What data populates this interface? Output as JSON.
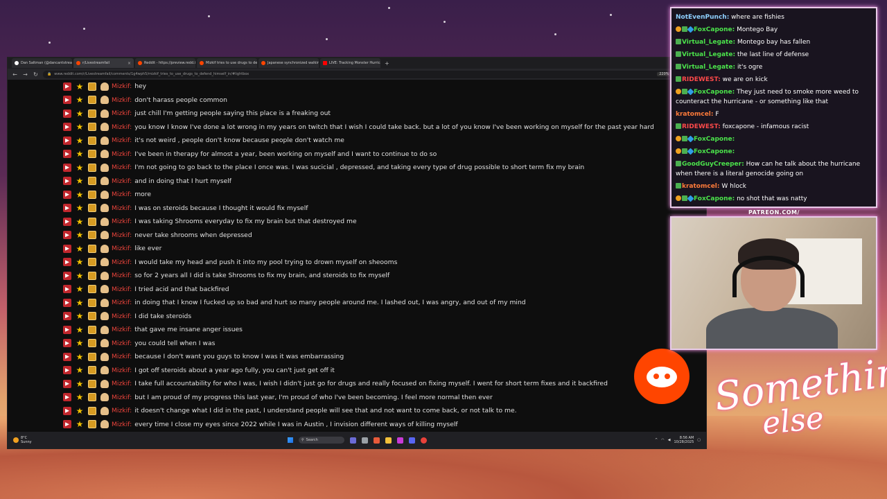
{
  "browser": {
    "tabs": [
      {
        "label": "Dan Saltman (@dancantstream)",
        "icon": "x-icon",
        "active": false
      },
      {
        "label": "r/Livestreamfail",
        "icon": "reddit-icon",
        "active": true
      },
      {
        "label": "Reddit - https://preview.redd.it/",
        "icon": "reddit-icon",
        "active": false
      },
      {
        "label": "Mizkif tries to use drugs to def",
        "icon": "reddit-icon",
        "active": false
      },
      {
        "label": "Japanese synchronized walking",
        "icon": "reddit-icon",
        "active": false
      },
      {
        "label": "LIVE: Tracking Monster Hurrican",
        "icon": "youtube-icon",
        "active": false
      }
    ],
    "url": "www.reddit.com/r/Livestreamfail/comments/1g4wph5/mizkif_tries_to_use_drugs_to_defend_himself_in/#lightbox",
    "zoom": "220%"
  },
  "chat": {
    "username": "Mizkif:",
    "messages": [
      "hey",
      "don't harass people common",
      "just chill I'm getting people saying this place is a freaking out",
      "you know I know I've done a lot wrong in my years on twitch that I wish I could take back. but a lot of you know I've been working on myself for the past year hard",
      "it's not weird , people don't know because people don't watch me",
      "I've been in therapy for almost a year, been working on myself and I want to continue to do so",
      "I'm not going to go back to the place I once was. I was sucicial , depressed, and taking every type of drug possible to short term fix my brain",
      "and in doing that I hurt myself",
      "more",
      "I was on steroids because I thought it would fix myself",
      "I was taking Shrooms everyday to fix my brain but that destroyed me",
      "never take shrooms when depressed",
      "like ever",
      "I would take my head and push it into my pool trying to drown myself on sheooms",
      "so for 2 years all I did is take Shrooms to fix my brain, and steroids to fix myself",
      "I tried acid and that backfired",
      "in doing that I know I fucked up so bad and hurt so many people around me. I lashed out, I was angry, and out of my mind",
      "I did take steroids",
      "that gave me insane anger issues",
      "you could tell when I was",
      "because I don't want you guys to know I was it was embarrassing",
      "I got off steroids about a year ago fully, you can't just get off it",
      "I take full accountability for who I was, I wish I didn't just go for drugs and really focused on fixing myself. I went for short term fixes and it backfired",
      "but I am proud of my progress this last year, I'm proud of who I've been becoming. I feel more normal then ever",
      "it doesn't change what I did in the past, I understand people will see that and not want to come back, or not talk to me.",
      "every time I close my eyes since 2022 while I was in Austin , I invision different ways of killing myself"
    ]
  },
  "taskbar": {
    "weather_temp": "8°C",
    "weather_desc": "Sunny",
    "search_label": "Search",
    "time": "8:56 AM",
    "date": "10/28/2025"
  },
  "stream_chat": [
    {
      "user": "NotEvenPunch:",
      "color": "#8fd0ff",
      "badges": [],
      "text": "where are fishies"
    },
    {
      "user": "FoxCapone:",
      "color": "#4be34b",
      "badges": [
        "sub",
        "mod",
        "vip"
      ],
      "text": "Montego Bay"
    },
    {
      "user": "Virtual_Legate:",
      "color": "#4be34b",
      "badges": [
        "mod"
      ],
      "text": "Montego bay has fallen"
    },
    {
      "user": "Virtual_Legate:",
      "color": "#4be34b",
      "badges": [
        "mod"
      ],
      "text": "the last line of defense"
    },
    {
      "user": "Virtual_Legate:",
      "color": "#4be34b",
      "badges": [
        "mod"
      ],
      "text": "it's ogre"
    },
    {
      "user": "RIDEWEST:",
      "color": "#ff4a4a",
      "badges": [
        "mod"
      ],
      "text": "we are on kick"
    },
    {
      "user": "FoxCapone:",
      "color": "#4be34b",
      "badges": [
        "sub",
        "mod",
        "vip"
      ],
      "text": "They just need to smoke more weed to counteract the hurricane - or something like that"
    },
    {
      "user": "kratomcel:",
      "color": "#ff7b3a",
      "badges": [],
      "text": "F"
    },
    {
      "user": "RIDEWEST:",
      "color": "#ff4a4a",
      "badges": [
        "mod"
      ],
      "text": "foxcapone - infamous racist"
    },
    {
      "user": "FoxCapone:",
      "color": "#4be34b",
      "badges": [
        "sub",
        "mod",
        "vip"
      ],
      "text": ""
    },
    {
      "user": "FoxCapone:",
      "color": "#4be34b",
      "badges": [
        "sub",
        "mod",
        "vip"
      ],
      "text": ""
    },
    {
      "user": "GoodGuyCreeper:",
      "color": "#4be34b",
      "badges": [
        "mod"
      ],
      "text": "How can he talk about the hurricane when there is a literal genocide going on"
    },
    {
      "user": "kratomcel:",
      "color": "#ff7b3a",
      "badges": [
        "mod"
      ],
      "text": "W hlock"
    },
    {
      "user": "FoxCapone:",
      "color": "#4be34b",
      "badges": [
        "sub",
        "mod",
        "vip"
      ],
      "text": "no shot that was natty"
    }
  ],
  "overlay": {
    "patreon": "PATREON.COM/",
    "brand_line1": "Something",
    "brand_line2": "else"
  }
}
